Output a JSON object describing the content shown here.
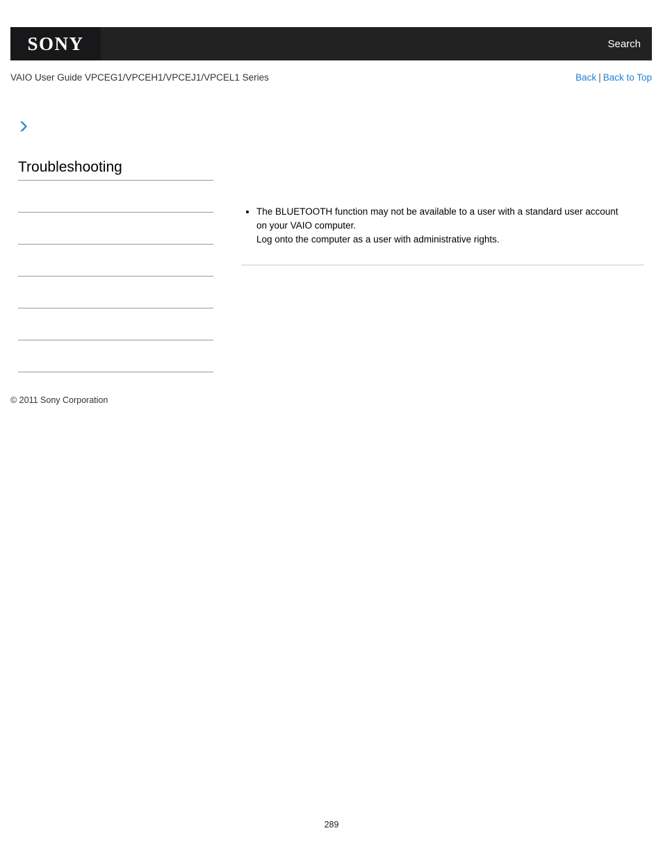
{
  "header": {
    "logo_text": "SONY",
    "search_label": "Search",
    "background_color": "#222222",
    "logo_box_color": "#18181a"
  },
  "breadcrumb": {
    "title": "VAIO User Guide VPCEG1/VPCEH1/VPCEJ1/VPCEL1 Series",
    "back_label": "Back",
    "separator": "|",
    "back_to_top_label": "Back to Top",
    "link_color": "#1f7fd4"
  },
  "chevron_icon": {
    "name": "chevron-right-icon",
    "color": "#2a86c8"
  },
  "sidebar": {
    "heading": "Troubleshooting",
    "items": [
      {
        "label": ""
      },
      {
        "label": ""
      },
      {
        "label": ""
      },
      {
        "label": ""
      },
      {
        "label": ""
      },
      {
        "label": ""
      }
    ]
  },
  "main": {
    "bullets": [
      {
        "lines": [
          "The BLUETOOTH function may not be available to a user with a standard user account",
          "on your VAIO computer.",
          "Log onto the computer as a user with administrative rights."
        ]
      }
    ]
  },
  "footer": {
    "copyright": "© 2011 Sony Corporation",
    "page_number": "289"
  }
}
